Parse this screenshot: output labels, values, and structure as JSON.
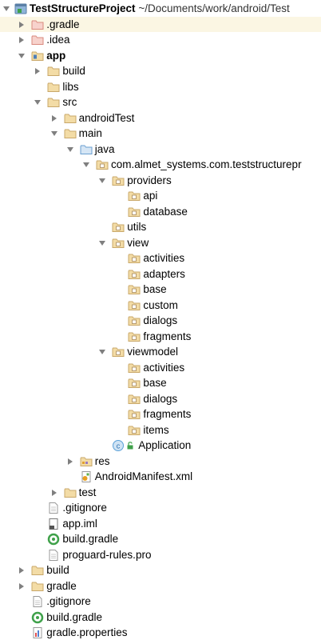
{
  "project": {
    "name": "TestStructureProject",
    "path": "~/Documents/work/android/Test"
  },
  "tree": [
    {
      "label": ".gradle",
      "depth": 1,
      "arrow": "right",
      "icon": "folder-red-icon",
      "selected": true
    },
    {
      "label": ".idea",
      "depth": 1,
      "arrow": "right",
      "icon": "folder-red-icon"
    },
    {
      "label": "app",
      "depth": 1,
      "arrow": "down",
      "icon": "module-folder-icon",
      "bold": true
    },
    {
      "label": "build",
      "depth": 2,
      "arrow": "right",
      "icon": "folder-icon"
    },
    {
      "label": "libs",
      "depth": 2,
      "arrow": "none",
      "icon": "folder-icon"
    },
    {
      "label": "src",
      "depth": 2,
      "arrow": "down",
      "icon": "folder-icon"
    },
    {
      "label": "androidTest",
      "depth": 3,
      "arrow": "right",
      "icon": "folder-icon"
    },
    {
      "label": "main",
      "depth": 3,
      "arrow": "down",
      "icon": "folder-icon"
    },
    {
      "label": "java",
      "depth": 4,
      "arrow": "down",
      "icon": "source-folder-icon"
    },
    {
      "label": "com.almet_systems.com.teststructurepr",
      "depth": 5,
      "arrow": "down",
      "icon": "package-icon"
    },
    {
      "label": "providers",
      "depth": 6,
      "arrow": "down",
      "icon": "package-icon"
    },
    {
      "label": "api",
      "depth": 7,
      "arrow": "none",
      "icon": "package-icon"
    },
    {
      "label": "database",
      "depth": 7,
      "arrow": "none",
      "icon": "package-icon"
    },
    {
      "label": "utils",
      "depth": 6,
      "arrow": "none",
      "icon": "package-icon"
    },
    {
      "label": "view",
      "depth": 6,
      "arrow": "down",
      "icon": "package-icon"
    },
    {
      "label": "activities",
      "depth": 7,
      "arrow": "none",
      "icon": "package-icon"
    },
    {
      "label": "adapters",
      "depth": 7,
      "arrow": "none",
      "icon": "package-icon"
    },
    {
      "label": "base",
      "depth": 7,
      "arrow": "none",
      "icon": "package-icon"
    },
    {
      "label": "custom",
      "depth": 7,
      "arrow": "none",
      "icon": "package-icon"
    },
    {
      "label": "dialogs",
      "depth": 7,
      "arrow": "none",
      "icon": "package-icon"
    },
    {
      "label": "fragments",
      "depth": 7,
      "arrow": "none",
      "icon": "package-icon"
    },
    {
      "label": "viewmodel",
      "depth": 6,
      "arrow": "down",
      "icon": "package-icon"
    },
    {
      "label": "activities",
      "depth": 7,
      "arrow": "none",
      "icon": "package-icon"
    },
    {
      "label": "base",
      "depth": 7,
      "arrow": "none",
      "icon": "package-icon"
    },
    {
      "label": "dialogs",
      "depth": 7,
      "arrow": "none",
      "icon": "package-icon"
    },
    {
      "label": "fragments",
      "depth": 7,
      "arrow": "none",
      "icon": "package-icon"
    },
    {
      "label": "items",
      "depth": 7,
      "arrow": "none",
      "icon": "package-icon"
    },
    {
      "label": "Application",
      "depth": 6,
      "arrow": "none",
      "icon": "class-icon"
    },
    {
      "label": "res",
      "depth": 4,
      "arrow": "right",
      "icon": "resource-folder-icon"
    },
    {
      "label": "AndroidManifest.xml",
      "depth": 4,
      "arrow": "none",
      "icon": "manifest-icon"
    },
    {
      "label": "test",
      "depth": 3,
      "arrow": "right",
      "icon": "folder-icon"
    },
    {
      "label": ".gitignore",
      "depth": 2,
      "arrow": "none",
      "icon": "text-file-icon"
    },
    {
      "label": "app.iml",
      "depth": 2,
      "arrow": "none",
      "icon": "iml-file-icon"
    },
    {
      "label": "build.gradle",
      "depth": 2,
      "arrow": "none",
      "icon": "gradle-file-icon"
    },
    {
      "label": "proguard-rules.pro",
      "depth": 2,
      "arrow": "none",
      "icon": "text-file-icon"
    },
    {
      "label": "build",
      "depth": 1,
      "arrow": "right",
      "icon": "folder-icon"
    },
    {
      "label": "gradle",
      "depth": 1,
      "arrow": "right",
      "icon": "folder-icon"
    },
    {
      "label": ".gitignore",
      "depth": 1,
      "arrow": "none",
      "icon": "text-file-icon"
    },
    {
      "label": "build.gradle",
      "depth": 1,
      "arrow": "none",
      "icon": "gradle-file-icon"
    },
    {
      "label": "gradle.properties",
      "depth": 1,
      "arrow": "none",
      "icon": "properties-file-icon"
    }
  ],
  "colors": {
    "folder": "#c9a86a",
    "folder_red": "#d9897e",
    "source_folder": "#6a9fd0",
    "selection": "#fbf6e3",
    "arrow": "#7f7f7f",
    "class_circle": "#5aa0d8",
    "gradle_green": "#3fa14a"
  }
}
